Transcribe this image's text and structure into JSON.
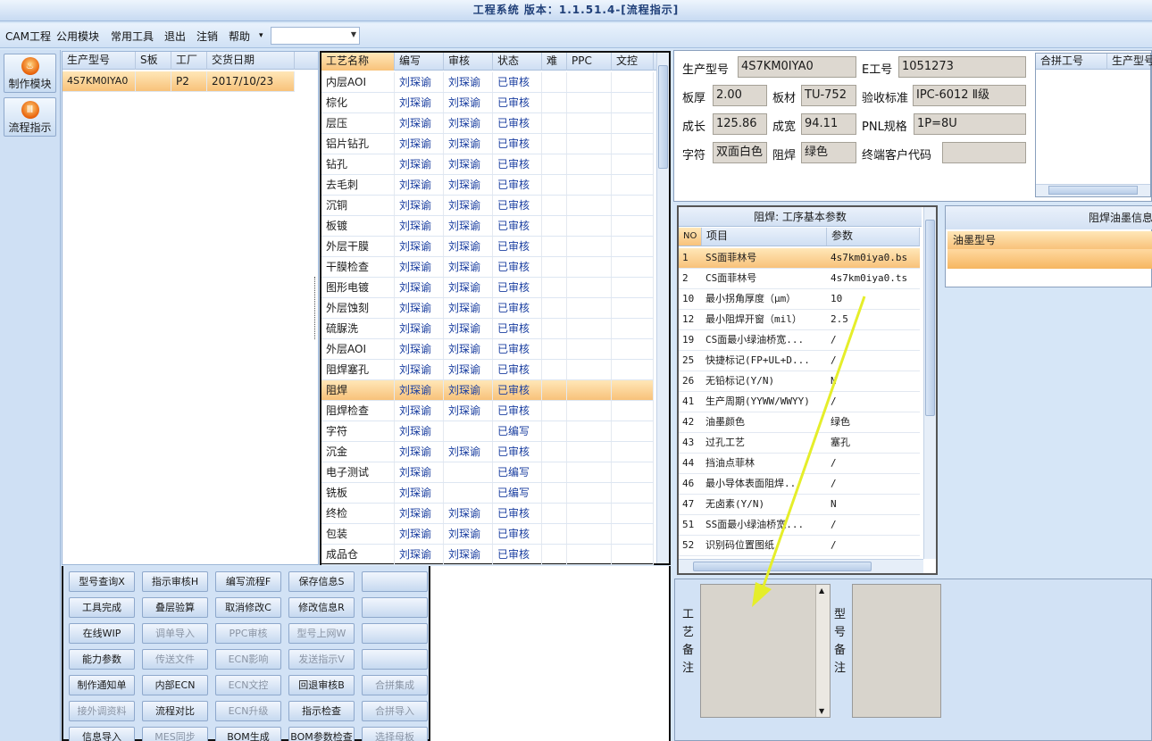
{
  "window": {
    "title": "工程系统 版本：1.1.51.4-[流程指示]"
  },
  "menu": [
    "CAM工程",
    "公用模块",
    "常用工具",
    "退出",
    "注销",
    "帮助"
  ],
  "menu_dropdown_arrow": "▾",
  "combo_value": "",
  "nav": [
    {
      "label": "制作模块",
      "icon": "fire-icon"
    },
    {
      "label": "流程指示",
      "icon": "flow-icon"
    }
  ],
  "order_grid": {
    "headers": [
      "生产型号",
      "S板",
      "工厂",
      "交货日期"
    ],
    "rows": [
      [
        "4S7KM0IYA0",
        "",
        "P2",
        "2017/10/23"
      ]
    ]
  },
  "process_grid": {
    "headers": [
      "工艺名称",
      "编写",
      "审核",
      "状态",
      "难",
      "PPC",
      "文控"
    ],
    "selected_index": 16,
    "rows": [
      [
        "内层AOI",
        "刘琛谕",
        "刘琛谕",
        "已审核"
      ],
      [
        "棕化",
        "刘琛谕",
        "刘琛谕",
        "已审核"
      ],
      [
        "层压",
        "刘琛谕",
        "刘琛谕",
        "已审核"
      ],
      [
        "铝片钻孔",
        "刘琛谕",
        "刘琛谕",
        "已审核"
      ],
      [
        "钻孔",
        "刘琛谕",
        "刘琛谕",
        "已审核"
      ],
      [
        "去毛刺",
        "刘琛谕",
        "刘琛谕",
        "已审核"
      ],
      [
        "沉铜",
        "刘琛谕",
        "刘琛谕",
        "已审核"
      ],
      [
        "板镀",
        "刘琛谕",
        "刘琛谕",
        "已审核"
      ],
      [
        "外层干膜",
        "刘琛谕",
        "刘琛谕",
        "已审核"
      ],
      [
        "干膜检查",
        "刘琛谕",
        "刘琛谕",
        "已审核"
      ],
      [
        "图形电镀",
        "刘琛谕",
        "刘琛谕",
        "已审核"
      ],
      [
        "外层蚀刻",
        "刘琛谕",
        "刘琛谕",
        "已审核"
      ],
      [
        "硫脲洗",
        "刘琛谕",
        "刘琛谕",
        "已审核"
      ],
      [
        "外层AOI",
        "刘琛谕",
        "刘琛谕",
        "已审核"
      ],
      [
        "阻焊塞孔",
        "刘琛谕",
        "刘琛谕",
        "已审核"
      ],
      [
        "阻焊",
        "刘琛谕",
        "刘琛谕",
        "已审核"
      ],
      [
        "阻焊检查",
        "刘琛谕",
        "刘琛谕",
        "已审核"
      ],
      [
        "字符",
        "刘琛谕",
        "",
        "已编写"
      ],
      [
        "沉金",
        "刘琛谕",
        "刘琛谕",
        "已审核"
      ],
      [
        "电子测试",
        "刘琛谕",
        "",
        "已编写"
      ],
      [
        "铣板",
        "刘琛谕",
        "",
        "已编写"
      ],
      [
        "终检",
        "刘琛谕",
        "刘琛谕",
        "已审核"
      ],
      [
        "包装",
        "刘琛谕",
        "刘琛谕",
        "已审核"
      ],
      [
        "成品仓",
        "刘琛谕",
        "刘琛谕",
        "已审核"
      ]
    ]
  },
  "buttons": [
    [
      "型号查询X",
      "指示审核H",
      "编写流程F",
      "保存信息S",
      ""
    ],
    [
      "工具完成",
      "叠层验算",
      "取消修改C",
      "修改信息R",
      ""
    ],
    [
      "在线WIP",
      "调单导入",
      "PPC审核",
      "型号上网W",
      ""
    ],
    [
      "能力参数",
      "传送文件",
      "ECN影响",
      "发送指示V",
      ""
    ],
    [
      "制作通知单",
      "内部ECN",
      "ECN文控",
      "回退审核B",
      "合拼集成"
    ],
    [
      "接外调资料",
      "流程对比",
      "ECN升级",
      "指示检查",
      "合拼导入"
    ],
    [
      "信息导入",
      "MES同步",
      "BOM生成",
      "BOM参数检查",
      "选择母板"
    ]
  ],
  "disabled_buttons": [
    "调单导入",
    "PPC审核",
    "型号上网W",
    "传送文件",
    "ECN影响",
    "发送指示V",
    "ECN文控",
    "合拼集成",
    "接外调资料",
    "ECN升级",
    "合拼导入",
    "MES同步",
    "选择母板"
  ],
  "info": {
    "prod_model_label": "生产型号",
    "prod_model": "4S7KM0IYA0",
    "e_no_label": "E工号",
    "e_no": "1051273",
    "thickness_label": "板厚",
    "thickness": "2.00",
    "material_label": "板材",
    "material": "TU-752",
    "standard_label": "验收标准",
    "standard": "IPC-6012 Ⅱ级",
    "length_label": "成长",
    "length": "125.86",
    "width_label": "成宽",
    "width": "94.11",
    "pnl_label": "PNL规格",
    "pnl": "1P=8U",
    "char_label": "字符",
    "char": "双面白色",
    "mask_label": "阻焊",
    "mask": "绿色",
    "customer_label": "终端客户代码",
    "customer": ""
  },
  "merge_grid": {
    "headers": [
      "合拼工号",
      "生产型号"
    ]
  },
  "params": {
    "title": "阻焊: 工序基本参数",
    "headers": [
      "NO",
      "项目",
      "参数"
    ],
    "rows": [
      [
        "1",
        "SS面菲林号",
        "4s7km0iya0.bs"
      ],
      [
        "2",
        "CS面菲林号",
        "4s7km0iya0.ts"
      ],
      [
        "10",
        "最小拐角厚度（μm）",
        "10"
      ],
      [
        "12",
        "最小阻焊开窗（mil）",
        "2.5"
      ],
      [
        "19",
        "CS面最小绿油桥宽...",
        "/"
      ],
      [
        "25",
        "快捷标记(FP+UL+D...",
        "/"
      ],
      [
        "26",
        "无铅标记(Y/N)",
        "N"
      ],
      [
        "41",
        "生产周期(YYWW/WWYY)",
        "/"
      ],
      [
        "42",
        "油墨颜色",
        "绿色"
      ],
      [
        "43",
        "过孔工艺",
        "塞孔"
      ],
      [
        "44",
        "挡油点菲林",
        "/"
      ],
      [
        "46",
        "最小导体表面阻焊...",
        "/"
      ],
      [
        "47",
        "无卤素(Y/N)",
        "N"
      ],
      [
        "51",
        "SS面最小绿油桥宽...",
        "/"
      ],
      [
        "52",
        "识别码位置图纸",
        "/"
      ]
    ]
  },
  "ink_info": {
    "title": "阻焊油墨信息",
    "header": "油墨型号"
  },
  "remarks": {
    "process_label": "工艺备注",
    "model_label": "型号备注"
  },
  "annotation_color": "#e5ee2a"
}
